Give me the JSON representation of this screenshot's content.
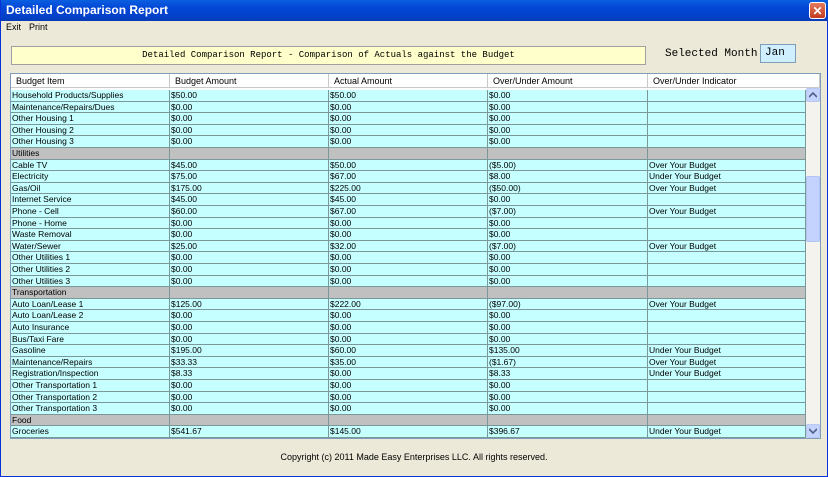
{
  "window": {
    "title": "Detailed Comparison Report",
    "close_glyph": "✕"
  },
  "menu": [
    {
      "label": "Exit"
    },
    {
      "label": "Print"
    }
  ],
  "report": {
    "title": "Detailed Comparison Report - Comparison of Actuals against the Budget",
    "selected_month_label": "Selected Month:",
    "selected_month": "Jan"
  },
  "table": {
    "columns": [
      "Budget Item",
      "Budget Amount",
      "Actual Amount",
      "Over/Under Amount",
      "Over/Under Indicator"
    ],
    "rows": [
      {
        "type": "data",
        "cells": [
          "Household Products/Supplies",
          "$50.00",
          "$50.00",
          "$0.00",
          ""
        ]
      },
      {
        "type": "data",
        "cells": [
          "Maintenance/Repairs/Dues",
          "$0.00",
          "$0.00",
          "$0.00",
          ""
        ]
      },
      {
        "type": "data",
        "cells": [
          "Other Housing 1",
          "$0.00",
          "$0.00",
          "$0.00",
          ""
        ]
      },
      {
        "type": "data",
        "cells": [
          "Other Housing 2",
          "$0.00",
          "$0.00",
          "$0.00",
          ""
        ]
      },
      {
        "type": "data",
        "cells": [
          "Other Housing 3",
          "$0.00",
          "$0.00",
          "$0.00",
          ""
        ]
      },
      {
        "type": "category",
        "cells": [
          "Utilities",
          "",
          "",
          "",
          ""
        ]
      },
      {
        "type": "data",
        "cells": [
          "Cable TV",
          "$45.00",
          "$50.00",
          "($5.00)",
          "Over Your Budget"
        ]
      },
      {
        "type": "data",
        "cells": [
          "Electricity",
          "$75.00",
          "$67.00",
          "$8.00",
          "Under Your Budget"
        ]
      },
      {
        "type": "data",
        "cells": [
          "Gas/Oil",
          "$175.00",
          "$225.00",
          "($50.00)",
          "Over Your Budget"
        ]
      },
      {
        "type": "data",
        "cells": [
          "Internet Service",
          "$45.00",
          "$45.00",
          "$0.00",
          ""
        ]
      },
      {
        "type": "data",
        "cells": [
          "Phone - Cell",
          "$60.00",
          "$67.00",
          "($7.00)",
          "Over Your Budget"
        ]
      },
      {
        "type": "data",
        "cells": [
          "Phone - Home",
          "$0.00",
          "$0.00",
          "$0.00",
          ""
        ]
      },
      {
        "type": "data",
        "cells": [
          "Waste Removal",
          "$0.00",
          "$0.00",
          "$0.00",
          ""
        ]
      },
      {
        "type": "data",
        "cells": [
          "Water/Sewer",
          "$25.00",
          "$32.00",
          "($7.00)",
          "Over Your Budget"
        ]
      },
      {
        "type": "data",
        "cells": [
          "Other Utilities 1",
          "$0.00",
          "$0.00",
          "$0.00",
          ""
        ]
      },
      {
        "type": "data",
        "cells": [
          "Other Utilities 2",
          "$0.00",
          "$0.00",
          "$0.00",
          ""
        ]
      },
      {
        "type": "data",
        "cells": [
          "Other Utilities 3",
          "$0.00",
          "$0.00",
          "$0.00",
          ""
        ]
      },
      {
        "type": "category",
        "cells": [
          "Transportation",
          "",
          "",
          "",
          ""
        ]
      },
      {
        "type": "data",
        "cells": [
          "Auto Loan/Lease 1",
          "$125.00",
          "$222.00",
          "($97.00)",
          "Over Your Budget"
        ]
      },
      {
        "type": "data",
        "cells": [
          "Auto Loan/Lease 2",
          "$0.00",
          "$0.00",
          "$0.00",
          ""
        ]
      },
      {
        "type": "data",
        "cells": [
          "Auto Insurance",
          "$0.00",
          "$0.00",
          "$0.00",
          ""
        ]
      },
      {
        "type": "data",
        "cells": [
          "Bus/Taxi Fare",
          "$0.00",
          "$0.00",
          "$0.00",
          ""
        ]
      },
      {
        "type": "data",
        "cells": [
          "Gasoline",
          "$195.00",
          "$60.00",
          "$135.00",
          "Under Your Budget"
        ]
      },
      {
        "type": "data",
        "cells": [
          "Maintenance/Repairs",
          "$33.33",
          "$35.00",
          "($1.67)",
          "Over Your Budget"
        ]
      },
      {
        "type": "data",
        "cells": [
          "Registration/Inspection",
          "$8.33",
          "$0.00",
          "$8.33",
          "Under Your Budget"
        ]
      },
      {
        "type": "data",
        "cells": [
          "Other Transportation 1",
          "$0.00",
          "$0.00",
          "$0.00",
          ""
        ]
      },
      {
        "type": "data",
        "cells": [
          "Other Transportation 2",
          "$0.00",
          "$0.00",
          "$0.00",
          ""
        ]
      },
      {
        "type": "data",
        "cells": [
          "Other Transportation 3",
          "$0.00",
          "$0.00",
          "$0.00",
          ""
        ]
      },
      {
        "type": "category",
        "cells": [
          "Food",
          "",
          "",
          "",
          ""
        ]
      },
      {
        "type": "data",
        "cells": [
          "Groceries",
          "$541.67",
          "$145.00",
          "$396.67",
          "Under Your Budget"
        ]
      }
    ]
  },
  "scrollbar": {
    "up_icon": "▲",
    "down_icon": "▼"
  },
  "footer": {
    "copyright": "Copyright (c) 2011 Made Easy Enterprises LLC. All rights reserved."
  },
  "colors": {
    "row_bg": "#C6FFFF",
    "category_bg": "#C0C0C0",
    "title_bg": "#FFFFCC",
    "month_bg": "#CFEFFF",
    "titlebar": "#0345D6"
  }
}
